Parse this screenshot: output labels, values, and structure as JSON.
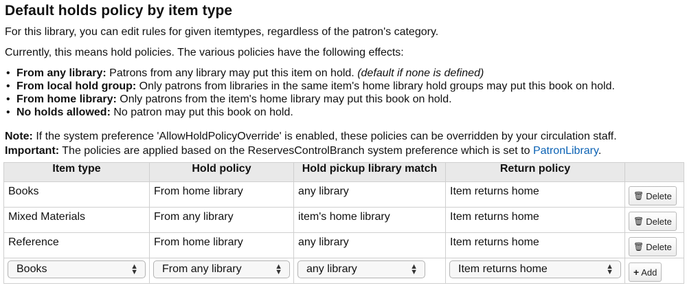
{
  "heading": "Default holds policy by item type",
  "intro1": "For this library, you can edit rules for given itemtypes, regardless of the patron's category.",
  "intro2": "Currently, this means hold policies. The various policies have the following effects:",
  "policies": [
    {
      "term": "From any library:",
      "desc": " Patrons from any library may put this item on hold. ",
      "extra": "(default if none is defined)"
    },
    {
      "term": "From local hold group:",
      "desc": " Only patrons from libraries in the same item's home library hold groups may put this book on hold.",
      "extra": ""
    },
    {
      "term": "From home library:",
      "desc": " Only patrons from the item's home library may put this book on hold.",
      "extra": ""
    },
    {
      "term": "No holds allowed:",
      "desc": " No patron may put this book on hold.",
      "extra": ""
    }
  ],
  "note": {
    "label": "Note:",
    "text": " If the system preference 'AllowHoldPolicyOverride' is enabled, these policies can be overridden by your circulation staff."
  },
  "important": {
    "label": "Important:",
    "text": " The policies are applied based on the ReservesControlBranch system preference which is set to ",
    "link": "PatronLibrary",
    "tail": "."
  },
  "table": {
    "headers": [
      "Item type",
      "Hold policy",
      "Hold pickup library match",
      "Return policy",
      ""
    ],
    "rows": [
      {
        "item_type": "Books",
        "hold_policy": "From home library",
        "pickup_match": "any library",
        "return_policy": "Item returns home",
        "action": "Delete"
      },
      {
        "item_type": "Mixed Materials",
        "hold_policy": "From any library",
        "pickup_match": "item's home library",
        "return_policy": "Item returns home",
        "action": "Delete"
      },
      {
        "item_type": "Reference",
        "hold_policy": "From home library",
        "pickup_match": "any library",
        "return_policy": "Item returns home",
        "action": "Delete"
      }
    ],
    "form": {
      "item_type": "Books",
      "hold_policy": "From any library",
      "pickup_match": "any library",
      "return_policy": "Item returns home",
      "add_label": "Add"
    }
  },
  "icons": {
    "delete": "trash-icon",
    "add": "plus-icon",
    "select": "updown-arrows-icon"
  },
  "colors": {
    "link": "#0b62b4",
    "header_bg": "#e9e9e9"
  }
}
